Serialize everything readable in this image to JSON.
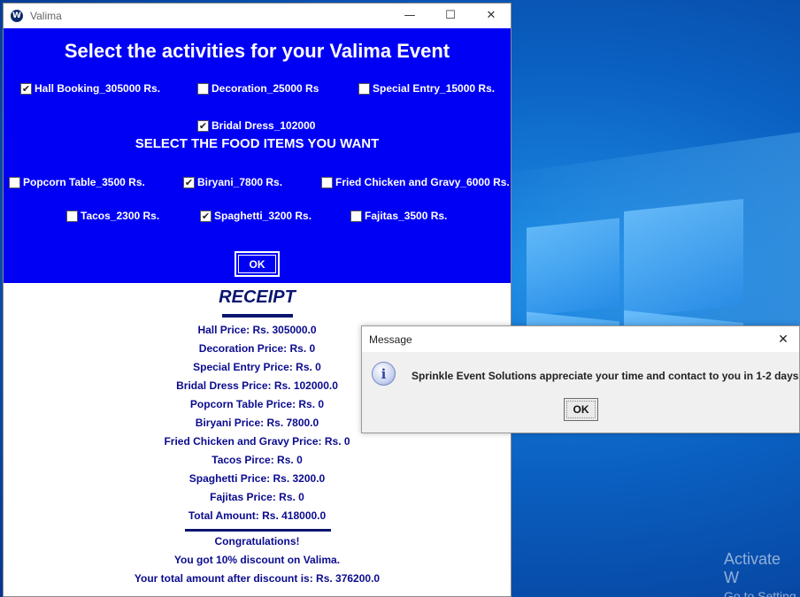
{
  "window": {
    "title": "Valima",
    "icon_letter": "W",
    "minimize": "—",
    "maximize": "☐",
    "close": "✕"
  },
  "form": {
    "heading": "Select the activities for your Valima Event",
    "food_heading": "SELECT THE FOOD ITEMS YOU WANT",
    "activities": [
      {
        "label": "Hall Booking_305000 Rs.",
        "checked": true
      },
      {
        "label": "Decoration_25000 Rs",
        "checked": false
      },
      {
        "label": "Special Entry_15000 Rs.",
        "checked": false
      },
      {
        "label": "Bridal Dress_102000",
        "checked": true
      }
    ],
    "food": [
      {
        "label": "Popcorn Table_3500 Rs.",
        "checked": false
      },
      {
        "label": "Biryani_7800 Rs.",
        "checked": true
      },
      {
        "label": "Fried Chicken and Gravy_6000 Rs.",
        "checked": false
      },
      {
        "label": "Tacos_2300 Rs.",
        "checked": false
      },
      {
        "label": "Spaghetti_3200 Rs.",
        "checked": true
      },
      {
        "label": "Fajitas_3500 Rs.",
        "checked": false
      }
    ],
    "ok_label": "OK"
  },
  "receipt": {
    "title": "RECEIPT",
    "lines": [
      "Hall Price: Rs. 305000.0",
      "Decoration Price: Rs. 0",
      "Special Entry Price: Rs. 0",
      "Bridal Dress Price:  Rs. 102000.0",
      "Popcorn Table Price: Rs. 0",
      "Biryani Price: Rs. 7800.0",
      "Fried Chicken and Gravy Price: Rs. 0",
      "Tacos Pirce: Rs. 0",
      "Spaghetti Price: Rs. 3200.0",
      "Fajitas Price: Rs. 0"
    ],
    "total": "Total Amount: Rs. 418000.0",
    "congrats": "Congratulations!",
    "discount": "You got 10% discount on Valima.",
    "after_discount": "Your total amount after discount is: Rs.  376200.0"
  },
  "dialog": {
    "title": "Message",
    "close": "✕",
    "icon": "info-icon",
    "icon_glyph": "i",
    "message": "Sprinkle Event Solutions appreciate your time and contact to you in 1-2 days",
    "ok_label": "OK"
  },
  "desktop": {
    "watermark_line1": "Activate W",
    "watermark_line2": "Go to Setting"
  },
  "colors": {
    "panel_blue": "#0000f5",
    "receipt_text": "#0b0b8f",
    "desktop_blue": "#0a64c8"
  }
}
